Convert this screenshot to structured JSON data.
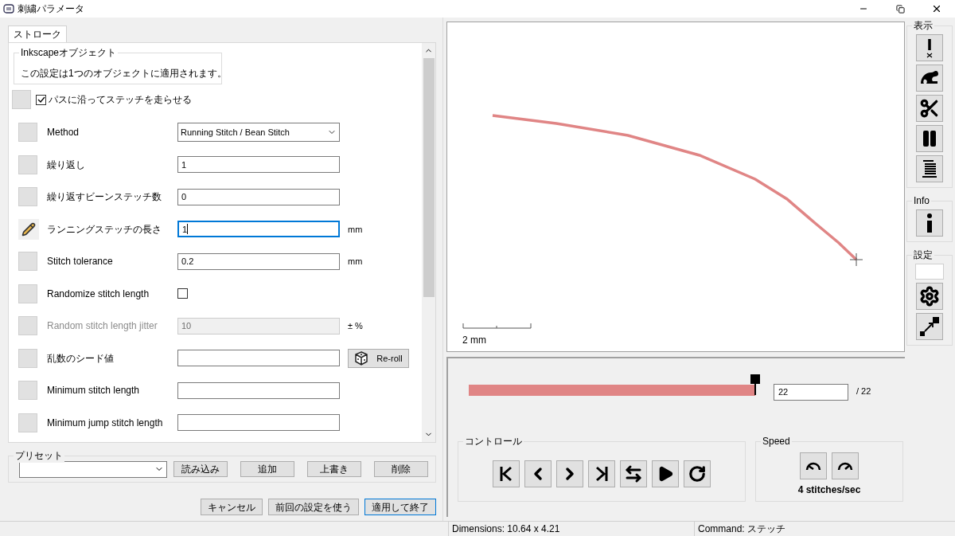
{
  "window": {
    "title": "刺繍パラメータ"
  },
  "tabs": [
    {
      "label": "ストローク",
      "selected": true
    }
  ],
  "object_group": {
    "title": "Inkscapeオブジェクト",
    "text": "この設定は1つのオブジェクトに適用されます。"
  },
  "main_toggle": {
    "label": "パスに沿ってステッチを走らせる",
    "checked": true
  },
  "params": [
    {
      "kind": "dropdown",
      "label": "Method",
      "value": "Running Stitch / Bean Stitch",
      "disabled": false,
      "modified": false
    },
    {
      "kind": "text",
      "label": "繰り返し",
      "value": "1",
      "disabled": false,
      "modified": false,
      "focused": false
    },
    {
      "kind": "text",
      "label": "繰り返すビーンステッチ数",
      "value": "0",
      "disabled": false,
      "modified": false,
      "focused": false
    },
    {
      "kind": "text",
      "label": "ランニングステッチの長さ",
      "value": "1",
      "unit": "mm",
      "disabled": false,
      "modified": true,
      "focused": true
    },
    {
      "kind": "text",
      "label": "Stitch tolerance",
      "value": "0.2",
      "unit": "mm",
      "disabled": false,
      "modified": false,
      "focused": false
    },
    {
      "kind": "checkbox",
      "label": "Randomize stitch length",
      "checked": false,
      "disabled": false,
      "modified": false
    },
    {
      "kind": "text",
      "label": "Random stitch length jitter",
      "value": "10",
      "unit": "± %",
      "disabled": true,
      "modified": false,
      "focused": false
    },
    {
      "kind": "text",
      "label": "乱数のシード値",
      "button": "Re-roll",
      "disabled": false,
      "modified": false,
      "focused": false
    },
    {
      "kind": "text",
      "label": "Minimum stitch length",
      "disabled": false,
      "modified": false,
      "focused": false
    },
    {
      "kind": "text",
      "label": "Minimum jump stitch length",
      "disabled": false,
      "modified": false,
      "focused": false
    }
  ],
  "presets": {
    "title": "プリセット",
    "buttons": [
      "読み込み",
      "追加",
      "上書き",
      "削除"
    ]
  },
  "footer_buttons": [
    {
      "label": "キャンセル",
      "default": false
    },
    {
      "label": "前回の設定を使う",
      "default": false
    },
    {
      "label": "適用して終了",
      "default": true
    }
  ],
  "preview": {
    "scale_label": "2 mm"
  },
  "slider": {
    "level": 1,
    "value": "22",
    "total": "/ 22"
  },
  "controls": {
    "title": "コントロール"
  },
  "speed": {
    "title": "Speed",
    "text": "4 stitches/sec"
  },
  "sidebar": [
    {
      "title": "表示"
    },
    {
      "title": "Info"
    },
    {
      "title": "設定"
    }
  ],
  "status_bar": {
    "dimensions": "Dimensions: 10.64 x 4.21",
    "command": "Command: ステッチ"
  }
}
